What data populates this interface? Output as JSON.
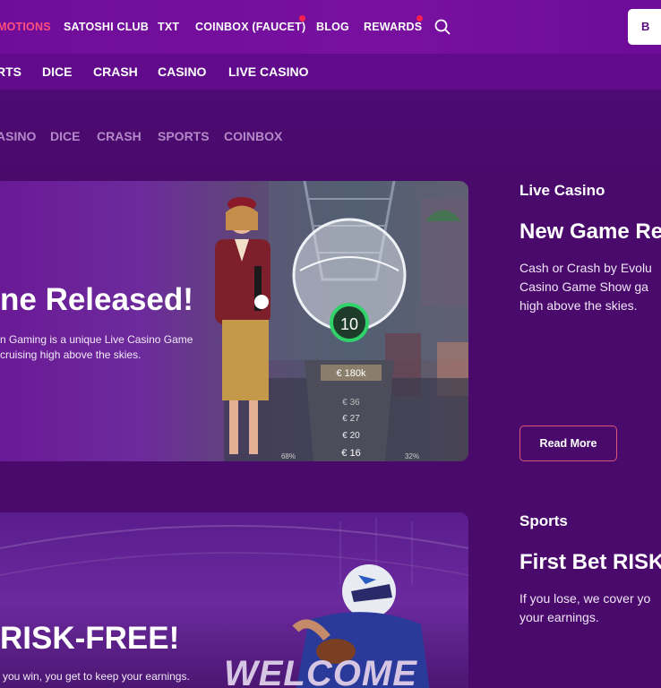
{
  "topnav": {
    "items": [
      {
        "label": "MOTIONS",
        "active": true
      },
      {
        "label": "SATOSHI CLUB"
      },
      {
        "label": "TXT"
      },
      {
        "label": "COINBOX (FAUCET)",
        "badge": true
      },
      {
        "label": "BLOG"
      },
      {
        "label": "REWARDS",
        "badge": true
      }
    ],
    "wallet_label": "B",
    "active_color": "#ff4f7c"
  },
  "gamenav": {
    "items": [
      "RTS",
      "DICE",
      "CRASH",
      "CASINO",
      "LIVE CASINO"
    ]
  },
  "tabs": [
    "ASINO",
    "DICE",
    "CRASH",
    "SPORTS",
    "COINBOX"
  ],
  "promo1": {
    "banner_title": "ne Released!",
    "banner_desc_line1": "n Gaming is a unique Live Casino Game",
    "banner_desc_line2": "cruising high above the skies.",
    "ball_number": "10",
    "board_top": "€ 180k",
    "board_values": [
      "€ 36",
      "€ 27",
      "€ 20",
      "€ 16"
    ],
    "pct_left": "68%",
    "pct_right": "32%",
    "category": "Live Casino",
    "title": "New Game Re",
    "desc_line1": "Cash or Crash by Evolu",
    "desc_line2": "Casino Game Show ga",
    "desc_line3": "high above the skies.",
    "button": "Read More"
  },
  "promo2": {
    "banner_title": "RISK-FREE!",
    "banner_desc": "you win, you get to keep your earnings.",
    "welcome_text": "WELCOME",
    "category": "Sports",
    "title": "First Bet RISK-",
    "desc_line1": "If you lose, we cover yo",
    "desc_line2": "your earnings."
  },
  "colors": {
    "top_bg": "#78109f",
    "game_bg": "#610b8c",
    "page_bg": "#4a0a6c",
    "badge": "#ff1f4e",
    "button_border": "#d9577c"
  }
}
